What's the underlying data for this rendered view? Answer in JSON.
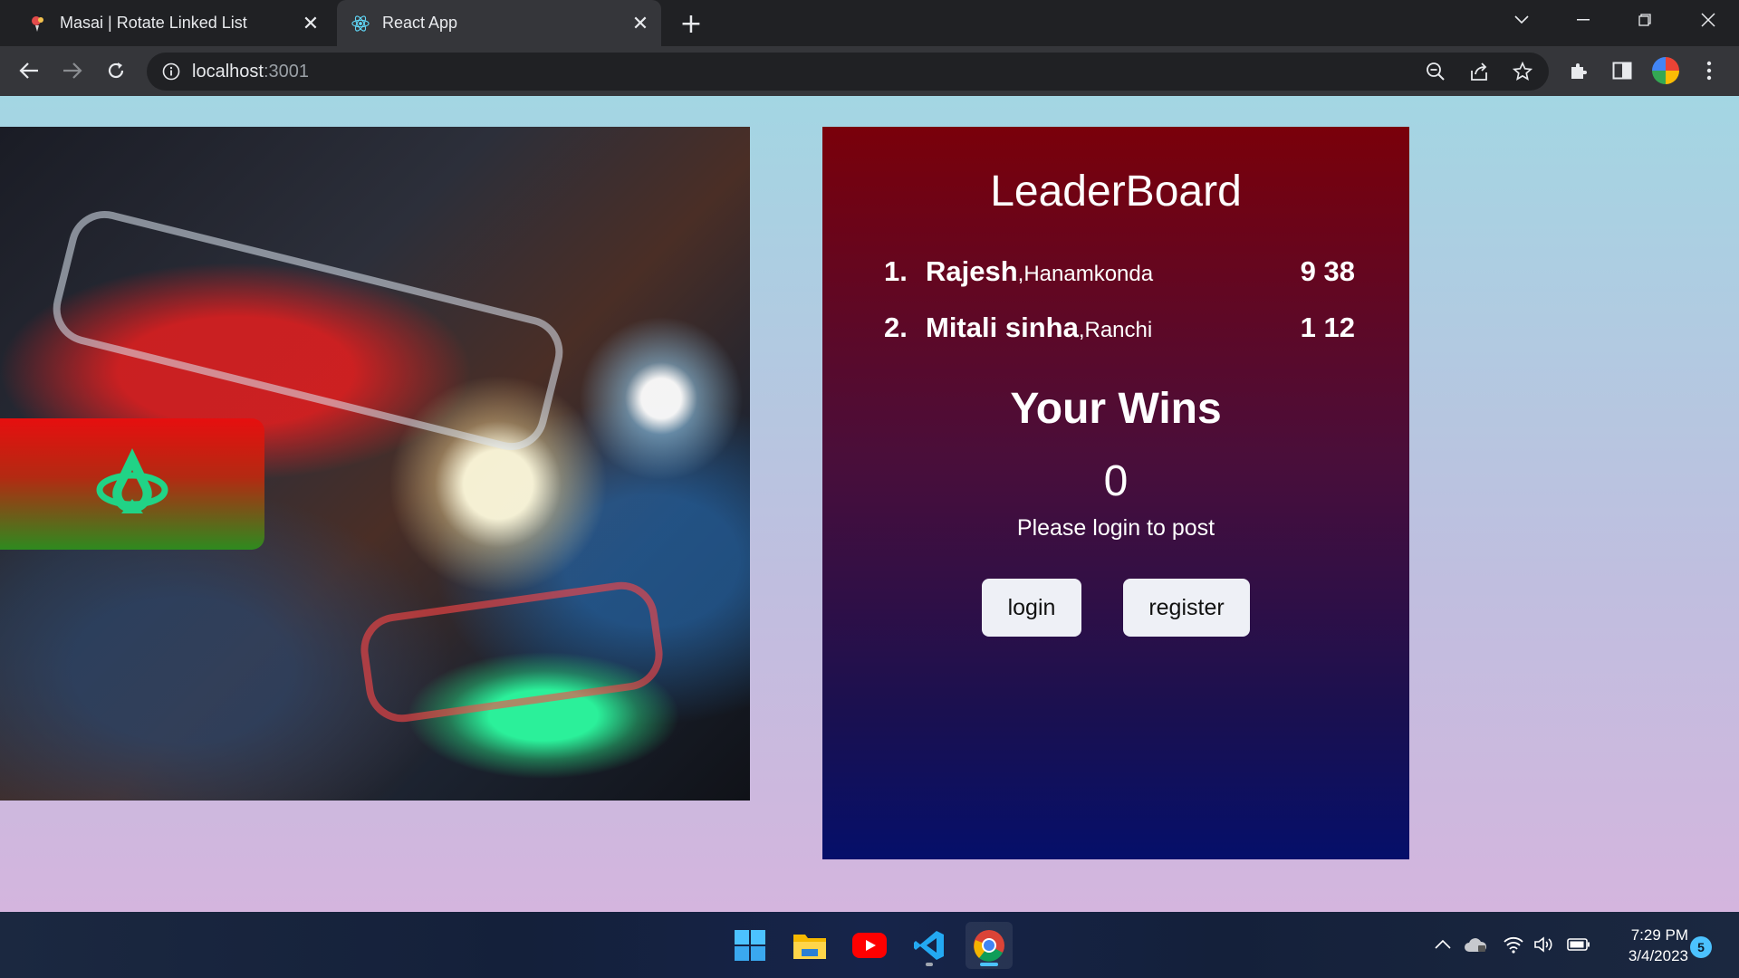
{
  "browser": {
    "tabs": [
      {
        "title": "Masai | Rotate Linked List",
        "icon": "masai-favicon",
        "active": false
      },
      {
        "title": "React App",
        "icon": "react-favicon",
        "active": true
      }
    ],
    "new_tab_icon": "plus-icon",
    "address": {
      "host": "localhost",
      "port": ":3001"
    }
  },
  "page": {
    "leaderboard": {
      "title": "LeaderBoard",
      "entries": [
        {
          "rank": "1.",
          "name": "Rajesh",
          "city": " ,Hanamkonda",
          "score": "9 38"
        },
        {
          "rank": "2.",
          "name": "Mitali sinha",
          "city": " ,Ranchi",
          "score": "1 12"
        }
      ]
    },
    "wins": {
      "title": "Your Wins",
      "count": "0",
      "message": "Please login to post"
    },
    "buttons": {
      "login": "login",
      "register": "register"
    },
    "colors": {
      "board_top": "#7a000a",
      "board_bottom": "#050f6a",
      "ship": "#21d386"
    }
  },
  "taskbar": {
    "apps": [
      "windows-start-icon",
      "file-explorer-icon",
      "youtube-icon",
      "vscode-icon",
      "chrome-icon"
    ],
    "clock": {
      "time": "7:29 PM",
      "date": "3/4/2023"
    },
    "notifications": "5"
  }
}
